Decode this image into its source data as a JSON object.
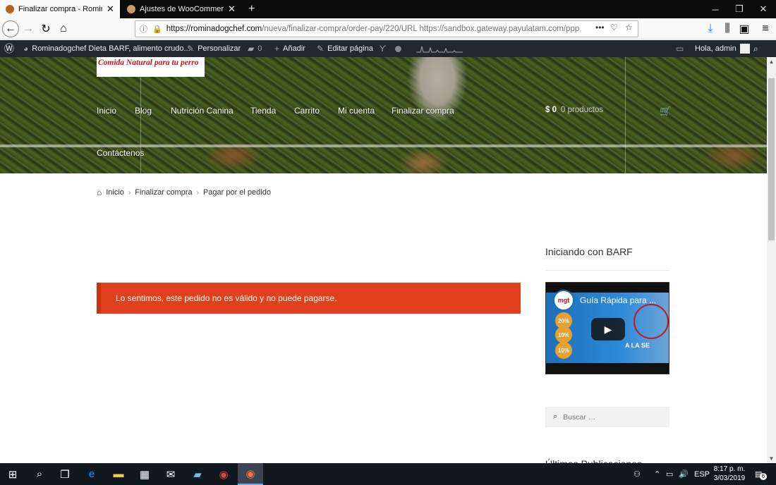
{
  "browser": {
    "tabs": [
      {
        "title": "Finalizar compra - Rominadogchef",
        "active": true
      },
      {
        "title": "Ajustes de WooCommerce ‹ Ro",
        "active": false
      }
    ],
    "new_tab": "+",
    "url_host": "https://rominadogchef.com",
    "url_rest": "/nueva/finalizar-compra/order-pay/220/URL https://sandbox.gateway.payulatam.com/ppp-web-ga",
    "page_actions": "•••"
  },
  "adminbar": {
    "site": "Rominadogchef Dieta BARF, alimento crudo...",
    "personalizar": "Personalizar",
    "comments_count": "0",
    "anadir": "Añadir",
    "editar": "Editar página",
    "greeting": "Hola, admin"
  },
  "site": {
    "logo_text": "Comida Natural para tu perro",
    "menu": [
      "Inicio",
      "Blog",
      "Nutrición Canina",
      "Tienda",
      "Carrito",
      "Mi cuenta",
      "Finalizar compra",
      "Contáctenos"
    ],
    "cart_amount": "$ 0",
    "cart_count": "0 productos"
  },
  "breadcrumb": [
    "Inicio",
    "Finalizar compra",
    "Pagar por el pedido"
  ],
  "error_message": "Lo sentimos, este pedido no es válido y no puede pagarse.",
  "sidebar": {
    "widget_title": "Iniciando con BARF",
    "video_title": "Guía Rápida para ...",
    "video_badge": "mgt",
    "video_percents": [
      "20%",
      "10%",
      "10%"
    ],
    "video_caption": "A LA SE",
    "search_placeholder": "Buscar …",
    "next_widget_title": "Últimas Publicaciones"
  },
  "taskbar": {
    "lang": "ESP",
    "time": "8:17 p. m.",
    "date": "3/03/2019",
    "notifications": "6"
  },
  "colors": {
    "error_bg": "#e2401c",
    "adminbar_bg": "#23282d",
    "tabstrip_bg": "#0c0c0d"
  }
}
